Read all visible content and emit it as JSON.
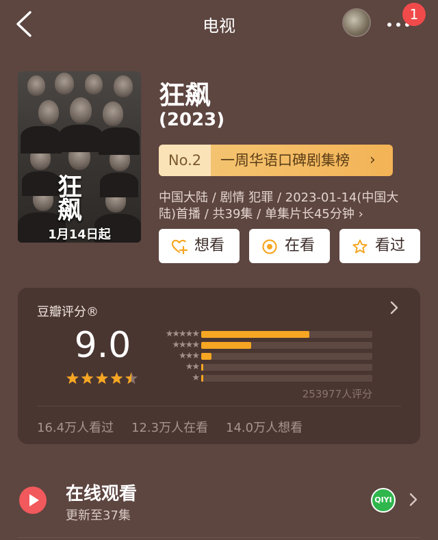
{
  "header": {
    "title": "电视",
    "notification_count": "1"
  },
  "poster": {
    "title_glyphs": "狂飙",
    "date_text": "1月14日起"
  },
  "show": {
    "title": "狂飙",
    "year": "(2023)",
    "rank": {
      "number": "No.2",
      "label": "一周华语口碑剧集榜",
      "arrow": "›"
    },
    "info_line1": "中国大陆 / 剧情 犯罪 / 2023-01-14(中国大",
    "info_line2": "陆)首播 / 共39集 / 单集片长45分钟 ›"
  },
  "actions": {
    "want": "想看",
    "watching": "在看",
    "watched": "看过"
  },
  "rating": {
    "label": "豆瓣评分®",
    "score": "9.0",
    "star_value": 4.5,
    "distribution": [
      {
        "stars": "★★★★★",
        "fraction": 0.63
      },
      {
        "stars": "★★★★",
        "fraction": 0.29
      },
      {
        "stars": "★★★",
        "fraction": 0.06
      },
      {
        "stars": "★★",
        "fraction": 0.01
      },
      {
        "stars": "★",
        "fraction": 0.01
      }
    ],
    "votes": "253977人评分",
    "stats": {
      "watched": "16.4万人看过",
      "watching": "12.3万人在看",
      "want": "14.0万人想看"
    }
  },
  "watch_online": {
    "title": "在线观看",
    "subtitle": "更新至37集",
    "platform": "QIYI"
  },
  "colors": {
    "background": "#5d4540",
    "card": "#4a3631",
    "accent_orange": "#f6a623",
    "play_red": "#f2595c",
    "badge_red": "#f04a4a",
    "platform_green": "#2fb64c"
  },
  "icons": {
    "back": "chevron-left-icon",
    "more": "more-dots-icon",
    "want": "heart-plus-icon",
    "watching": "target-circle-icon",
    "watched": "star-outline-icon",
    "play": "play-icon"
  }
}
